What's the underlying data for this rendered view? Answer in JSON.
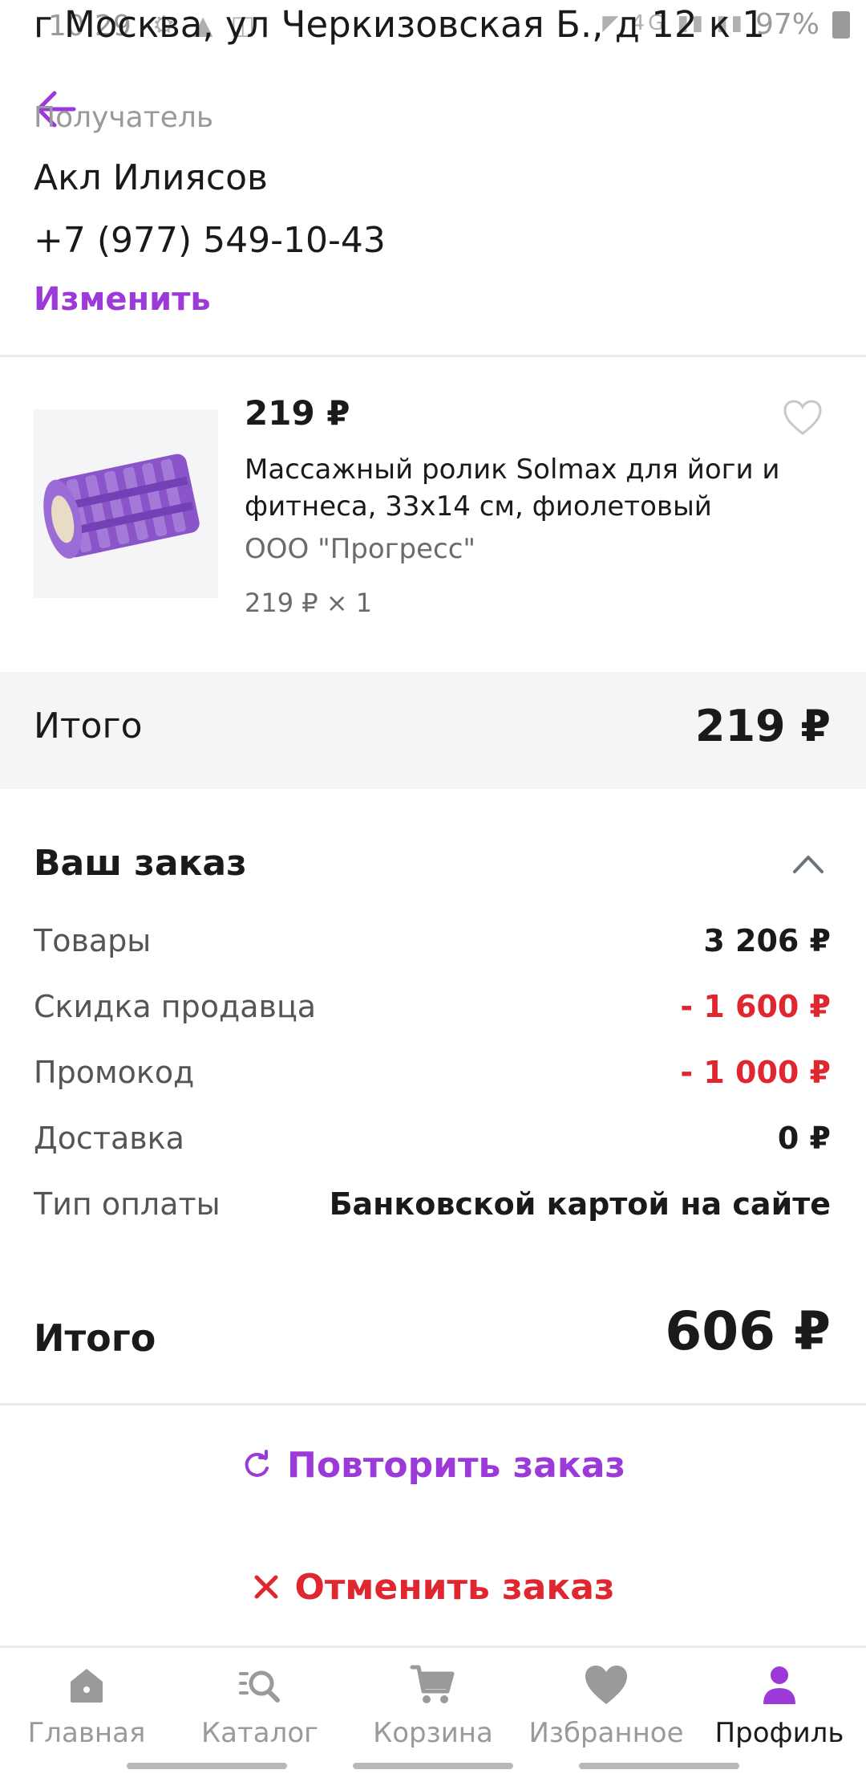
{
  "status_bar": {
    "time": "10:29",
    "battery": "97%"
  },
  "header": {
    "address": "г Москва, ул Черкизовская Б., д 12 к 1"
  },
  "recipient": {
    "label": "Получатель",
    "name": "Акл Илиясов",
    "phone": "+7 (977) 549-10-43",
    "change_link": "Изменить"
  },
  "product": {
    "price": "219 ₽",
    "title": "Массажный ролик Solmax для йоги и фитнеса, 33x14 см, фиолетовый",
    "seller": "ООО \"Прогресс\"",
    "quantity": "219 ₽ × 1"
  },
  "subtotal": {
    "label": "Итого",
    "value": "219 ₽"
  },
  "order_summary": {
    "heading": "Ваш заказ",
    "rows": [
      {
        "label": "Товары",
        "value": "3 206 ₽"
      },
      {
        "label": "Скидка продавца",
        "value": "- 1 600 ₽"
      },
      {
        "label": "Промокод",
        "value": "- 1 000 ₽"
      },
      {
        "label": "Доставка",
        "value": "0 ₽"
      },
      {
        "label": "Тип оплаты",
        "value": "Банковской картой на сайте"
      }
    ],
    "total_label": "Итого",
    "total_value": "606 ₽"
  },
  "actions": {
    "repeat": "Повторить заказ",
    "cancel": "Отменить заказ"
  },
  "bottom_nav": [
    {
      "label": "Главная",
      "icon": "home-icon"
    },
    {
      "label": "Каталог",
      "icon": "catalog-search-icon"
    },
    {
      "label": "Корзина",
      "icon": "cart-icon"
    },
    {
      "label": "Избранное",
      "icon": "heart-icon"
    },
    {
      "label": "Профиль",
      "icon": "profile-icon",
      "active": true
    }
  ],
  "colors": {
    "accent": "#9b3ad9",
    "danger": "#e0262f",
    "muted": "#9a9a9a"
  }
}
